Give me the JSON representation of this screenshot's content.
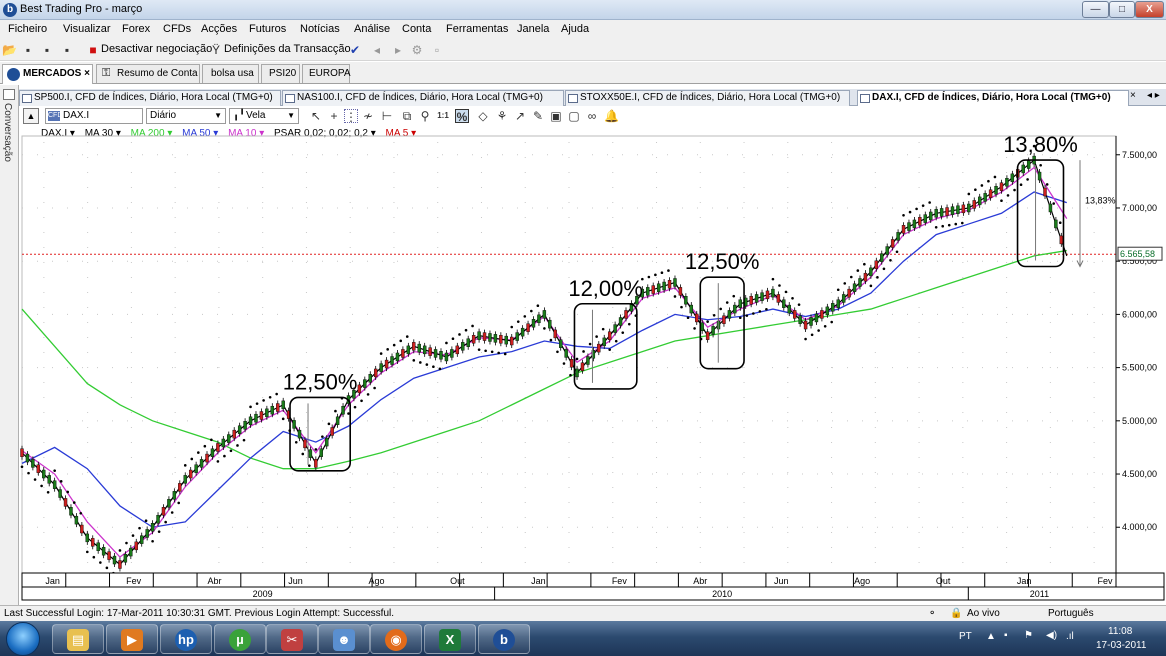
{
  "window": {
    "title": "Best Trading Pro - março",
    "min_label": "—",
    "max_label": "□",
    "close_label": "X"
  },
  "menu": [
    "Ficheiro",
    "Visualizar",
    "Forex",
    "CFDs",
    "Acções",
    "Futuros",
    "Notícias",
    "Análise",
    "Conta",
    "Ferramentas",
    "Janela",
    "Ajuda"
  ],
  "toolbar": {
    "deactivate_label": "Desactivar negociação",
    "settings_label": "Definições da Transacção"
  },
  "workspace_tabs": [
    {
      "label": "MERCADOS ×"
    },
    {
      "label": "Resumo de Conta"
    },
    {
      "label": "bolsa usa"
    },
    {
      "label": "PSI20"
    },
    {
      "label": "EUROPA"
    }
  ],
  "side_label": "Conversação",
  "chart_tabs": [
    {
      "label": "SP500.I, CFD de Índices, Diário, Hora Local (TMG+0)"
    },
    {
      "label": "NAS100.I, CFD de Índices, Diário, Hora Local (TMG+0)"
    },
    {
      "label": "STOXX50E.I, CFD de Índices, Diário, Hora Local (TMG+0)"
    },
    {
      "label": "DAX.I, CFD de Índices, Diário, Hora Local (TMG+0)"
    }
  ],
  "chart_toolbar": {
    "symbol": "DAX.I",
    "period": "Diário",
    "chart_style": "Vela"
  },
  "indicators": [
    {
      "label": "DAX.I ▾",
      "color": "#000000"
    },
    {
      "label": "MA 30 ▾",
      "color": "#000000"
    },
    {
      "label": "MA 200 ▾",
      "color": "#33cc33"
    },
    {
      "label": "MA 50 ▾",
      "color": "#2a3bd6"
    },
    {
      "label": "MA 10 ▾",
      "color": "#cc33cc"
    },
    {
      "label": "PSAR 0,02; 0,02; 0,2 ▾",
      "color": "#000000"
    },
    {
      "label": "MA 5 ▾",
      "color": "#cc0000"
    }
  ],
  "chart_data": {
    "type": "line",
    "y_axis_labels": [
      "7.500,00",
      "7.000,00",
      "6.500,00",
      "6.000,00",
      "5.500,00",
      "5.000,00",
      "4.500,00",
      "4.000,00"
    ],
    "y_ticks": [
      7500,
      7000,
      6500,
      6000,
      5500,
      5000,
      4500,
      4000
    ],
    "ylim": [
      3570,
      7620
    ],
    "month_labels": [
      "Jan",
      "Fev",
      "Abr",
      "Jun",
      "Ago",
      "Out",
      "Jan",
      "Fev",
      "Abr",
      "Jun",
      "Ago",
      "Out",
      "Jan",
      "Fev"
    ],
    "year_labels": [
      "2009",
      "2010",
      "2011"
    ],
    "current_price_label": "6.565,58",
    "current_price": 6565.58,
    "price_line_color": "#e02020",
    "series": [
      {
        "color": "#000000",
        "role": "price",
        "values": [
          4700,
          4400,
          3900,
          3650,
          4000,
          4450,
          4750,
          5000,
          5150,
          4600,
          5200,
          5500,
          5700,
          5600,
          5800,
          5750,
          6000,
          5450,
          5800,
          6200,
          6300,
          5800,
          6100,
          6200,
          5900,
          6100,
          6400,
          6800,
          6950,
          7000,
          7200,
          7450,
          6550
        ]
      },
      {
        "color": "#cc33cc",
        "role": "MA 10",
        "values": [
          4720,
          4500,
          4050,
          3720,
          3950,
          4380,
          4700,
          4950,
          5100,
          4700,
          5150,
          5450,
          5650,
          5620,
          5780,
          5760,
          5980,
          5550,
          5750,
          6150,
          6250,
          5880,
          6050,
          6180,
          5950,
          6080,
          6350,
          6750,
          6900,
          6980,
          7150,
          7380,
          6900
        ]
      },
      {
        "color": "#2a3bd6",
        "role": "MA 50",
        "values": [
          4600,
          4750,
          4550,
          4200,
          4000,
          4050,
          4350,
          4650,
          4900,
          4800,
          4950,
          5200,
          5400,
          5500,
          5600,
          5650,
          5750,
          5700,
          5680,
          5850,
          6000,
          5950,
          5980,
          6050,
          5980,
          6050,
          6200,
          6500,
          6750,
          6850,
          6950,
          7150,
          7050
        ]
      },
      {
        "color": "#33cc33",
        "role": "MA 200",
        "values": [
          6050,
          5700,
          5350,
          5150,
          5000,
          4900,
          4800,
          4650,
          4550,
          4550,
          4620,
          4700,
          4800,
          4900,
          5000,
          5150,
          5300,
          5450,
          5550,
          5650,
          5750,
          5800,
          5850,
          5900,
          5950,
          6000,
          6050,
          6150,
          6250,
          6350,
          6450,
          6550,
          6600
        ]
      }
    ],
    "annotations": [
      {
        "label": "12,50%",
        "x_range": [
          0.245,
          0.3
        ],
        "y_range": [
          4530,
          5220
        ]
      },
      {
        "label": "12,00%",
        "x_range": [
          0.505,
          0.562
        ],
        "y_range": [
          5300,
          6100
        ]
      },
      {
        "label": "12,50%",
        "x_range": [
          0.62,
          0.66
        ],
        "y_range": [
          5490,
          6350
        ]
      },
      {
        "label": "13,80%",
        "x_range": [
          0.91,
          0.952
        ],
        "y_range": [
          6450,
          7450
        ]
      }
    ],
    "measure_label": "13,83%"
  },
  "status": {
    "login_text": "Last Successful Login: 17-Mar-2011 10:30:31 GMT. Previous Login Attempt: Successful.",
    "mode": "Ao vivo",
    "language": "Português"
  },
  "taskbar": {
    "lang": "PT",
    "time": "11:08",
    "date": "17-03-2011"
  }
}
